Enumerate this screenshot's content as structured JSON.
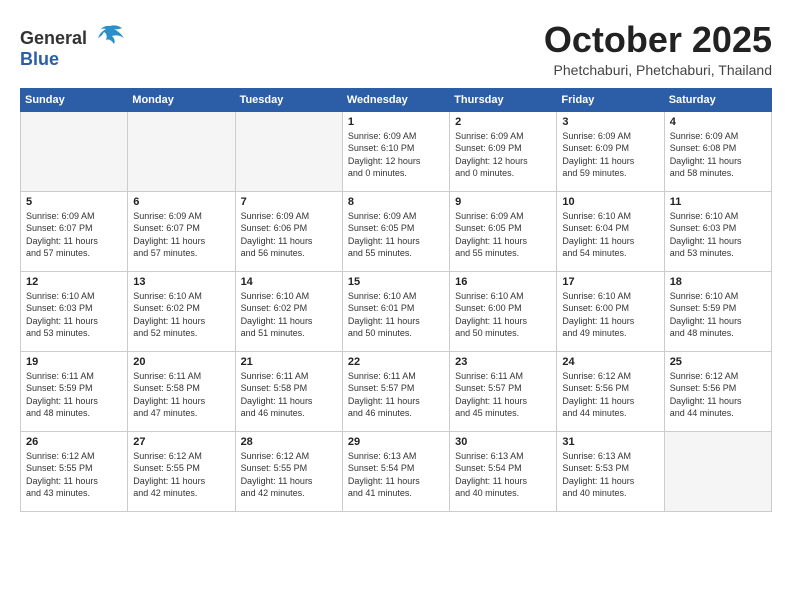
{
  "logo": {
    "general": "General",
    "blue": "Blue"
  },
  "title": "October 2025",
  "subtitle": "Phetchaburi, Phetchaburi, Thailand",
  "days_of_week": [
    "Sunday",
    "Monday",
    "Tuesday",
    "Wednesday",
    "Thursday",
    "Friday",
    "Saturday"
  ],
  "weeks": [
    [
      {
        "day": "",
        "info": ""
      },
      {
        "day": "",
        "info": ""
      },
      {
        "day": "",
        "info": ""
      },
      {
        "day": "1",
        "info": "Sunrise: 6:09 AM\nSunset: 6:10 PM\nDaylight: 12 hours\nand 0 minutes."
      },
      {
        "day": "2",
        "info": "Sunrise: 6:09 AM\nSunset: 6:09 PM\nDaylight: 12 hours\nand 0 minutes."
      },
      {
        "day": "3",
        "info": "Sunrise: 6:09 AM\nSunset: 6:09 PM\nDaylight: 11 hours\nand 59 minutes."
      },
      {
        "day": "4",
        "info": "Sunrise: 6:09 AM\nSunset: 6:08 PM\nDaylight: 11 hours\nand 58 minutes."
      }
    ],
    [
      {
        "day": "5",
        "info": "Sunrise: 6:09 AM\nSunset: 6:07 PM\nDaylight: 11 hours\nand 57 minutes."
      },
      {
        "day": "6",
        "info": "Sunrise: 6:09 AM\nSunset: 6:07 PM\nDaylight: 11 hours\nand 57 minutes."
      },
      {
        "day": "7",
        "info": "Sunrise: 6:09 AM\nSunset: 6:06 PM\nDaylight: 11 hours\nand 56 minutes."
      },
      {
        "day": "8",
        "info": "Sunrise: 6:09 AM\nSunset: 6:05 PM\nDaylight: 11 hours\nand 55 minutes."
      },
      {
        "day": "9",
        "info": "Sunrise: 6:09 AM\nSunset: 6:05 PM\nDaylight: 11 hours\nand 55 minutes."
      },
      {
        "day": "10",
        "info": "Sunrise: 6:10 AM\nSunset: 6:04 PM\nDaylight: 11 hours\nand 54 minutes."
      },
      {
        "day": "11",
        "info": "Sunrise: 6:10 AM\nSunset: 6:03 PM\nDaylight: 11 hours\nand 53 minutes."
      }
    ],
    [
      {
        "day": "12",
        "info": "Sunrise: 6:10 AM\nSunset: 6:03 PM\nDaylight: 11 hours\nand 53 minutes."
      },
      {
        "day": "13",
        "info": "Sunrise: 6:10 AM\nSunset: 6:02 PM\nDaylight: 11 hours\nand 52 minutes."
      },
      {
        "day": "14",
        "info": "Sunrise: 6:10 AM\nSunset: 6:02 PM\nDaylight: 11 hours\nand 51 minutes."
      },
      {
        "day": "15",
        "info": "Sunrise: 6:10 AM\nSunset: 6:01 PM\nDaylight: 11 hours\nand 50 minutes."
      },
      {
        "day": "16",
        "info": "Sunrise: 6:10 AM\nSunset: 6:00 PM\nDaylight: 11 hours\nand 50 minutes."
      },
      {
        "day": "17",
        "info": "Sunrise: 6:10 AM\nSunset: 6:00 PM\nDaylight: 11 hours\nand 49 minutes."
      },
      {
        "day": "18",
        "info": "Sunrise: 6:10 AM\nSunset: 5:59 PM\nDaylight: 11 hours\nand 48 minutes."
      }
    ],
    [
      {
        "day": "19",
        "info": "Sunrise: 6:11 AM\nSunset: 5:59 PM\nDaylight: 11 hours\nand 48 minutes."
      },
      {
        "day": "20",
        "info": "Sunrise: 6:11 AM\nSunset: 5:58 PM\nDaylight: 11 hours\nand 47 minutes."
      },
      {
        "day": "21",
        "info": "Sunrise: 6:11 AM\nSunset: 5:58 PM\nDaylight: 11 hours\nand 46 minutes."
      },
      {
        "day": "22",
        "info": "Sunrise: 6:11 AM\nSunset: 5:57 PM\nDaylight: 11 hours\nand 46 minutes."
      },
      {
        "day": "23",
        "info": "Sunrise: 6:11 AM\nSunset: 5:57 PM\nDaylight: 11 hours\nand 45 minutes."
      },
      {
        "day": "24",
        "info": "Sunrise: 6:12 AM\nSunset: 5:56 PM\nDaylight: 11 hours\nand 44 minutes."
      },
      {
        "day": "25",
        "info": "Sunrise: 6:12 AM\nSunset: 5:56 PM\nDaylight: 11 hours\nand 44 minutes."
      }
    ],
    [
      {
        "day": "26",
        "info": "Sunrise: 6:12 AM\nSunset: 5:55 PM\nDaylight: 11 hours\nand 43 minutes."
      },
      {
        "day": "27",
        "info": "Sunrise: 6:12 AM\nSunset: 5:55 PM\nDaylight: 11 hours\nand 42 minutes."
      },
      {
        "day": "28",
        "info": "Sunrise: 6:12 AM\nSunset: 5:55 PM\nDaylight: 11 hours\nand 42 minutes."
      },
      {
        "day": "29",
        "info": "Sunrise: 6:13 AM\nSunset: 5:54 PM\nDaylight: 11 hours\nand 41 minutes."
      },
      {
        "day": "30",
        "info": "Sunrise: 6:13 AM\nSunset: 5:54 PM\nDaylight: 11 hours\nand 40 minutes."
      },
      {
        "day": "31",
        "info": "Sunrise: 6:13 AM\nSunset: 5:53 PM\nDaylight: 11 hours\nand 40 minutes."
      },
      {
        "day": "",
        "info": ""
      }
    ]
  ]
}
